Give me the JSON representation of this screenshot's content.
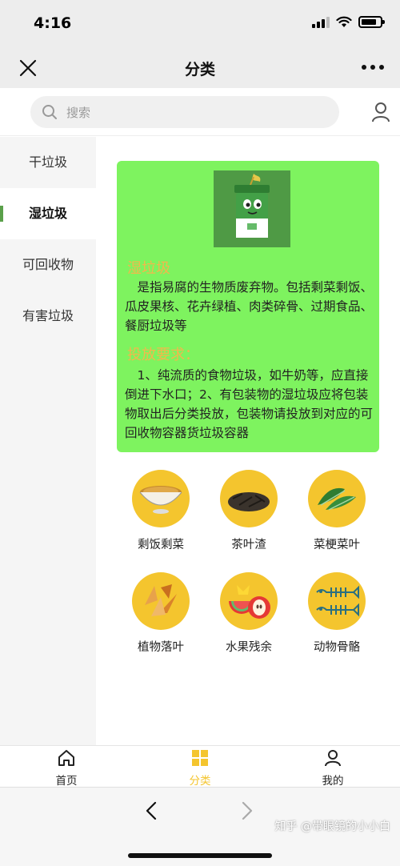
{
  "status": {
    "time": "4:16"
  },
  "nav": {
    "title": "分类"
  },
  "search": {
    "placeholder": "搜索"
  },
  "sidebar": {
    "items": [
      {
        "label": "干垃圾"
      },
      {
        "label": "湿垃圾"
      },
      {
        "label": "可回收物"
      },
      {
        "label": "有害垃圾"
      }
    ],
    "active_index": 1
  },
  "card": {
    "heading": "湿垃圾",
    "description": "是指易腐的生物质废弃物。包括剩菜剩饭、瓜皮果核、花卉绿植、肉类碎骨、过期食品、餐厨垃圾等",
    "rules_heading": "投放要求：",
    "rules": "1、纯流质的食物垃圾，如牛奶等，应直接倒进下水口；2、有包装物的湿垃圾应将包装物取出后分类投放，包装物请投放到对应的可回收物容器货垃圾容器"
  },
  "items": [
    {
      "label": "剩饭剩菜"
    },
    {
      "label": "茶叶渣"
    },
    {
      "label": "菜梗菜叶"
    },
    {
      "label": "植物落叶"
    },
    {
      "label": "水果残余"
    },
    {
      "label": "动物骨骼"
    }
  ],
  "tabs": [
    {
      "label": "首页"
    },
    {
      "label": "分类"
    },
    {
      "label": "我的"
    }
  ],
  "watermark": "知乎 @带眼镜的小小白",
  "colors": {
    "card_bg": "#7ef35f",
    "accent": "#f4c52e",
    "heading": "#f2b84c",
    "active_marker": "#5aa04a"
  }
}
